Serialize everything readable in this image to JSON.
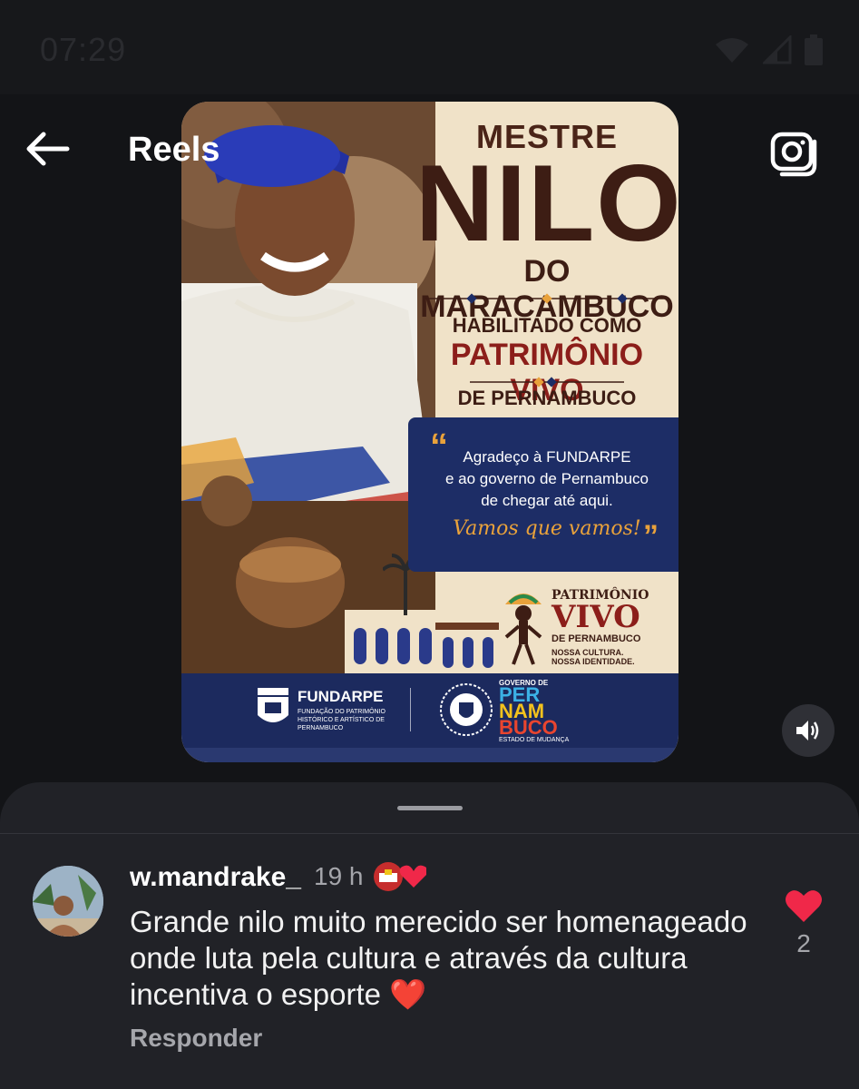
{
  "status_bar": {
    "time": "07:29",
    "icons": [
      "wifi-icon",
      "signal-icon",
      "battery-icon"
    ]
  },
  "header": {
    "title": "Reels",
    "back_icon": "arrow-left-icon",
    "camera_icon": "camera-icon"
  },
  "poster": {
    "title_small": "MESTRE",
    "title_big": "NILO",
    "subtitle": "DO MARACAMBUCO",
    "habilitado": "HABILITADO COMO",
    "patrimonio": "PATRIMÔNIO VIVO",
    "de_pe": "DE PERNAMBUCO",
    "quote_line1": "Agradeço à FUNDARPE",
    "quote_line2": "e ao governo de Pernambuco",
    "quote_line3": "de chegar até aqui.",
    "quote_slogan": "Vamos que vamos!",
    "pv_line1": "PATRIMÔNIO",
    "pv_line2": "VIVO",
    "pv_line3": "DE PERNAMBUCO",
    "pv_line4a": "NOSSA CULTURA.",
    "pv_line4b": "NOSSA IDENTIDADE.",
    "fundarpe_name": "FUNDARPE",
    "fundarpe_sub": "FUNDAÇÃO DO PATRIMÔNIO HISTÓRICO E ARTÍSTICO DE PERNAMBUCO",
    "gov_label": "GOVERNO DE",
    "pe_per": "PER",
    "pe_nam": "NAM",
    "pe_buco": "BUCO",
    "estado_label": "ESTADO DE MUDANÇA"
  },
  "comment": {
    "username": "w.mandrake_",
    "time_ago": "19 h",
    "text": "Grande nilo muito merecido ser homenageado onde luta pela cultura e através da cultura incentiva o esporte ❤️",
    "reply_label": "Responder",
    "like_count": "2"
  },
  "colors": {
    "background": "#131417",
    "sheet": "#212227",
    "like": "#f02849",
    "poster_navy": "#1c2a5e",
    "poster_cream": "#f0e2c8"
  }
}
